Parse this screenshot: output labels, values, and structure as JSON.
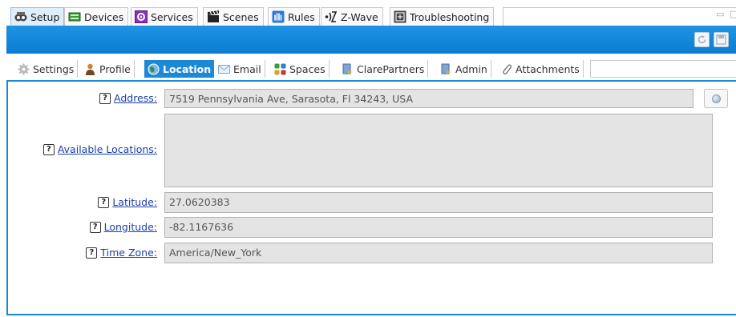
{
  "top_tabs": [
    {
      "label": "Setup",
      "icon": "setup-icon",
      "active": true
    },
    {
      "label": "Devices",
      "icon": "devices-icon"
    },
    {
      "label": "Services",
      "icon": "services-icon"
    },
    {
      "label": "Scenes",
      "icon": "scenes-icon"
    },
    {
      "label": "Rules",
      "icon": "rules-icon"
    },
    {
      "label": "Z-Wave",
      "icon": "zwave-icon"
    },
    {
      "label": "Troubleshooting",
      "icon": "troubleshooting-icon"
    }
  ],
  "sub_tabs": [
    {
      "label": "Settings",
      "icon": "gear-icon"
    },
    {
      "label": "Profile",
      "icon": "person-icon"
    },
    {
      "label": "Location",
      "icon": "globe-icon",
      "active": true
    },
    {
      "label": "Email",
      "icon": "envelope-icon"
    },
    {
      "label": "Spaces",
      "icon": "spaces-icon"
    },
    {
      "label": "ClarePartners",
      "icon": "partner-icon"
    },
    {
      "label": "Admin",
      "icon": "admin-icon"
    },
    {
      "label": "Attachments",
      "icon": "paperclip-icon"
    }
  ],
  "form": {
    "address": {
      "label": "Address:",
      "value": "7519 Pennsylvania Ave, Sarasota, Fl 34243, USA"
    },
    "available_locations": {
      "label": "Available Locations:",
      "value": ""
    },
    "latitude": {
      "label": "Latitude:",
      "value": "27.0620383"
    },
    "longitude": {
      "label": "Longitude:",
      "value": "-82.1167636"
    },
    "time_zone": {
      "label": "Time Zone:",
      "value": "America/New_York"
    }
  },
  "help_glyph": "?",
  "colors": {
    "accent": "#1c88d8",
    "toolbar": "#0a7dd0",
    "link": "#1a3fa8",
    "field_bg": "#e4e4e4"
  }
}
